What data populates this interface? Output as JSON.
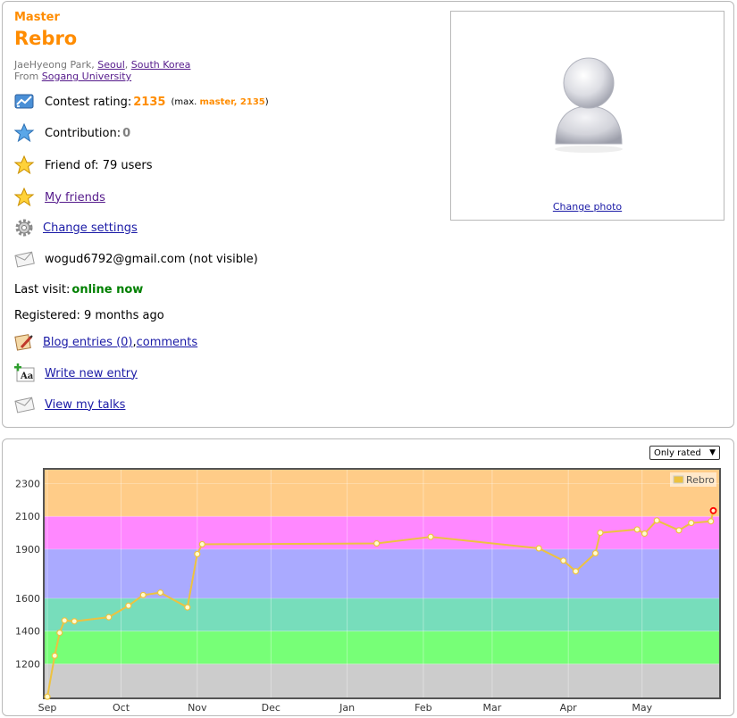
{
  "profile": {
    "rank": "Master",
    "handle": "Rebro",
    "name_line": "JaeHyeong Park, ",
    "city": "Seoul",
    "country": "South Korea",
    "from_label": "From ",
    "organization": "Sogang University",
    "contest_rating_label": "Contest rating: ",
    "contest_rating": "2135",
    "max_prefix": "(max. ",
    "max_rank": "master, 2135",
    "max_suffix": ")",
    "contribution_label": "Contribution: ",
    "contribution": "0",
    "friend_of": "Friend of: 79 users",
    "my_friends": "My friends",
    "change_settings": "Change settings",
    "email": "wogud6792@gmail.com (not visible)",
    "last_visit_label": "Last visit: ",
    "last_visit": "online now",
    "registered": "Registered: 9 months ago",
    "blog_entries": "Blog entries (0)",
    "comma": ", ",
    "comments": "comments",
    "write_new_entry": "Write new entry",
    "view_my_talks": "View my talks",
    "change_photo": "Change photo"
  },
  "graph": {
    "filter_select": "Only rated"
  },
  "chart_data": {
    "type": "line",
    "series": [
      {
        "name": "Rebro",
        "points": [
          [
            "Sep 1",
            1000
          ],
          [
            "Sep 4",
            1250
          ],
          [
            "Sep 6",
            1390
          ],
          [
            "Sep 8",
            1465
          ],
          [
            "Sep 12",
            1460
          ],
          [
            "Sep 26",
            1485
          ],
          [
            "Oct 4",
            1555
          ],
          [
            "Oct 10",
            1620
          ],
          [
            "Oct 17",
            1635
          ],
          [
            "Oct 28",
            1545
          ],
          [
            "Nov 1",
            1870
          ],
          [
            "Nov 3",
            1930
          ],
          [
            "Jan 13",
            1935
          ],
          [
            "Feb 4",
            1975
          ],
          [
            "Mar 20",
            1905
          ],
          [
            "Mar 30",
            1830
          ],
          [
            "Apr 4",
            1765
          ],
          [
            "Apr 12",
            1875
          ],
          [
            "Apr 14",
            2000
          ],
          [
            "Apr 29",
            2020
          ],
          [
            "May 2",
            1995
          ],
          [
            "May 7",
            2075
          ],
          [
            "May 16",
            2015
          ],
          [
            "May 21",
            2060
          ],
          [
            "May 29",
            2070
          ],
          [
            "May 30",
            2135
          ]
        ]
      }
    ],
    "y_ticks": [
      1200,
      1400,
      1600,
      1900,
      2100,
      2300
    ],
    "x_ticks": [
      "Sep",
      "Oct",
      "Nov",
      "Dec",
      "Jan",
      "Feb",
      "Mar",
      "Apr",
      "May"
    ],
    "ylim": [
      990,
      2390
    ],
    "bands": [
      {
        "from": 990,
        "to": 1200,
        "color": "#cccccc"
      },
      {
        "from": 1200,
        "to": 1400,
        "color": "#77ff77"
      },
      {
        "from": 1400,
        "to": 1600,
        "color": "#77ddbb"
      },
      {
        "from": 1600,
        "to": 1900,
        "color": "#aaaaff"
      },
      {
        "from": 1900,
        "to": 2100,
        "color": "#ff88ff"
      },
      {
        "from": 2100,
        "to": 2390,
        "color": "#ffcc88"
      }
    ],
    "line_color": "#edc240",
    "last_point_color": "#ff0000",
    "legend": "Rebro",
    "legend_position": "top-right",
    "grid": true
  }
}
